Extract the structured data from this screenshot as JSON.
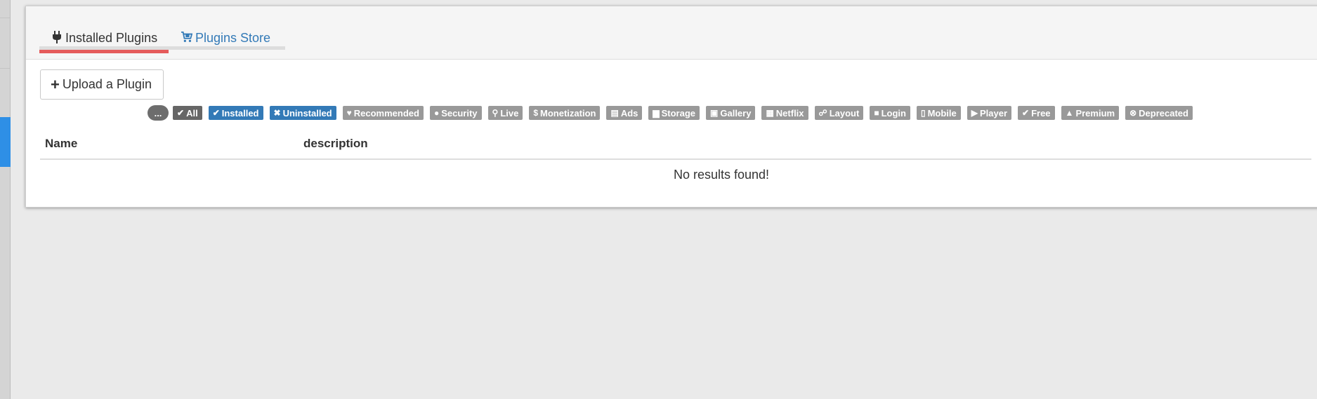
{
  "tabs": [
    {
      "label": "Installed Plugins",
      "icon": "plug-icon",
      "active": true
    },
    {
      "label": "Plugins Store",
      "icon": "cart-icon",
      "active": false
    }
  ],
  "upload_button": {
    "label": "Upload a Plugin",
    "icon": "plus-icon"
  },
  "filters": {
    "more_label": "...",
    "items": [
      {
        "label": "All",
        "icon": "double-check-icon",
        "style": "dark"
      },
      {
        "label": "Installed",
        "icon": "check-icon",
        "style": "blue"
      },
      {
        "label": "Uninstalled",
        "icon": "times-icon",
        "style": "blue"
      },
      {
        "label": "Recommended",
        "icon": "heart-icon",
        "style": "gray"
      },
      {
        "label": "Security",
        "icon": "user-shield-icon",
        "style": "gray"
      },
      {
        "label": "Live",
        "icon": "broadcast-icon",
        "style": "gray"
      },
      {
        "label": "Monetization",
        "icon": "dollar-icon",
        "style": "gray"
      },
      {
        "label": "Ads",
        "icon": "ad-icon",
        "style": "gray"
      },
      {
        "label": "Storage",
        "icon": "archive-icon",
        "style": "gray"
      },
      {
        "label": "Gallery",
        "icon": "images-icon",
        "style": "gray"
      },
      {
        "label": "Netflix",
        "icon": "film-icon",
        "style": "gray"
      },
      {
        "label": "Layout",
        "icon": "sitemap-icon",
        "style": "gray"
      },
      {
        "label": "Login",
        "icon": "lock-icon",
        "style": "gray"
      },
      {
        "label": "Mobile",
        "icon": "mobile-icon",
        "style": "gray"
      },
      {
        "label": "Player",
        "icon": "play-circle-icon",
        "style": "gray"
      },
      {
        "label": "Free",
        "icon": "check-icon",
        "style": "gray"
      },
      {
        "label": "Premium",
        "icon": "thumbs-up-icon",
        "style": "gray"
      },
      {
        "label": "Deprecated",
        "icon": "times-circle-icon",
        "style": "gray"
      }
    ]
  },
  "table": {
    "columns": [
      "Name",
      "description"
    ],
    "empty_message": "No results found!"
  },
  "colors": {
    "active_tab_underline": "#e55b5b",
    "link_blue": "#337ab7",
    "filter_gray": "#999999",
    "filter_dark": "#666666"
  }
}
